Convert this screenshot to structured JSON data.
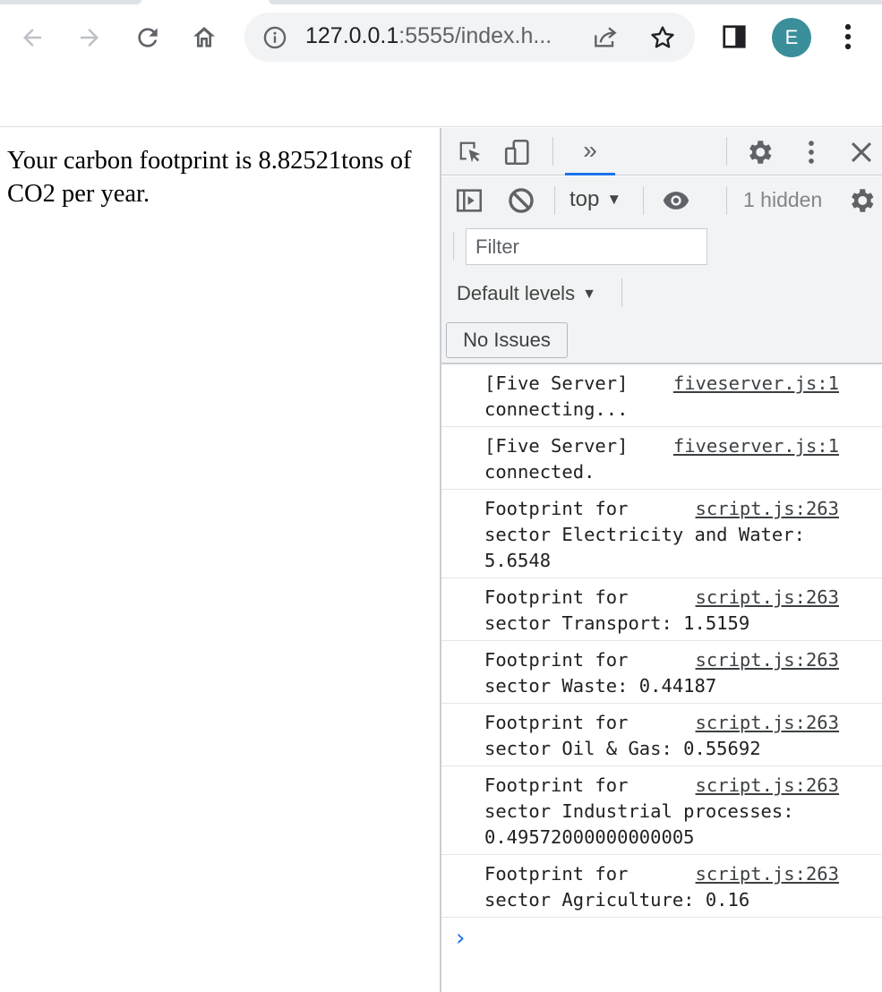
{
  "browser": {
    "url_host": "127.0.0.1",
    "url_path": ":5555/index.h...",
    "avatar_letter": "E",
    "accent_color": "#3a8f9a",
    "icons": [
      "back-arrow-icon",
      "forward-arrow-icon",
      "reload-icon",
      "home-icon",
      "info-icon",
      "share-icon",
      "star-icon",
      "side-panel-icon",
      "kebab-menu-icon"
    ]
  },
  "page": {
    "result_text": "Your carbon footprint is 8.82521tons of CO2 per year."
  },
  "devtools": {
    "tab_overflow": "»",
    "context": "top",
    "hidden_count": "1 hidden",
    "filter_placeholder": "Filter",
    "levels": "Default levels",
    "issues_button": "No Issues",
    "messages": [
      {
        "text": "[Five Server]\nconnecting...",
        "source": "fiveserver.js:1"
      },
      {
        "text": "[Five Server]\nconnected.",
        "source": "fiveserver.js:1"
      },
      {
        "text": "Footprint for\nsector Electricity and Water:\n5.6548",
        "source": "script.js:263"
      },
      {
        "text": "Footprint for\nsector Transport: 1.5159",
        "source": "script.js:263"
      },
      {
        "text": "Footprint for\nsector Waste: 0.44187",
        "source": "script.js:263"
      },
      {
        "text": "Footprint for\nsector Oil & Gas: 0.55692",
        "source": "script.js:263"
      },
      {
        "text": "Footprint for\nsector Industrial processes:\n0.49572000000000005",
        "source": "script.js:263"
      },
      {
        "text": "Footprint for\nsector Agriculture: 0.16",
        "source": "script.js:263"
      }
    ],
    "prompt_symbol": "›"
  }
}
